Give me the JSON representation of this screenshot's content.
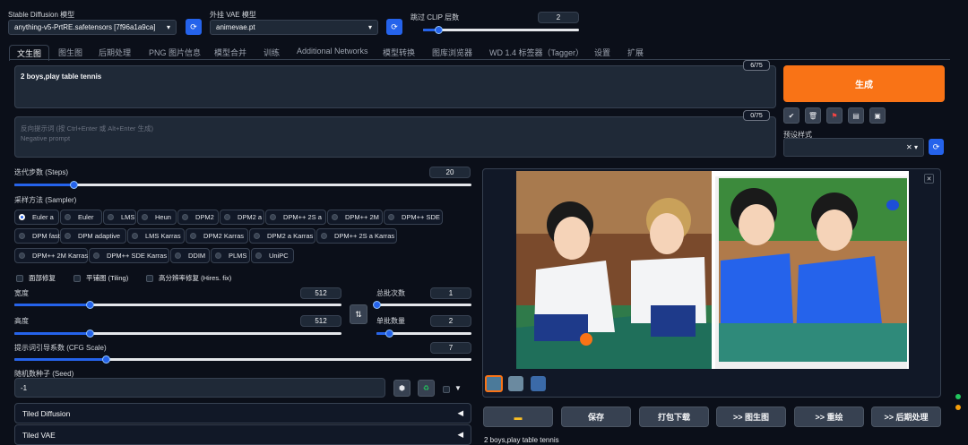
{
  "top": {
    "model_label": "Stable Diffusion 模型",
    "model_value": "anything-v5-PrtRE.safetensors [7f96a1a9ca]",
    "vae_label": "外挂 VAE 模型",
    "vae_value": "animevae.pt",
    "clip_label": "跳过 CLIP 层数",
    "clip_value": "2",
    "clip_level": 0.1
  },
  "tabs": [
    "文生图",
    "图生图",
    "后期处理",
    "PNG 图片信息",
    "模型合并",
    "训练",
    "Additional Networks",
    "模型转换",
    "图库浏览器",
    "WD 1.4 标签器（Tagger）",
    "设置",
    "扩展"
  ],
  "prompt": {
    "text": "2 boys,play table tennis",
    "count": "6/75",
    "neg_placeholder_1": "反向提示词 (按 Ctrl+Enter 或 Alt+Enter 生成)",
    "neg_placeholder_2": "Negative prompt",
    "neg_count": "0/75"
  },
  "generate": {
    "label": "生成",
    "style_label": "预设样式",
    "accent": "#f97316"
  },
  "tool_icons": [
    "check-icon",
    "trash-icon",
    "bookmark-icon",
    "clipboard-icon",
    "save-style-icon"
  ],
  "steps": {
    "label": "迭代步数 (Steps)",
    "value": "20",
    "level": 0.13
  },
  "sampler": {
    "label": "采样方法 (Sampler)",
    "selected": "Euler a",
    "options": [
      "Euler a",
      "Euler",
      "LMS",
      "Heun",
      "DPM2",
      "DPM2 a",
      "DPM++ 2S a",
      "DPM++ 2M",
      "DPM++ SDE",
      "DPM fast",
      "DPM adaptive",
      "LMS Karras",
      "DPM2 Karras",
      "DPM2 a Karras",
      "DPM++ 2S a Karras",
      "DPM++ 2M Karras",
      "DPM++ SDE Karras",
      "DDIM",
      "PLMS",
      "UniPC"
    ]
  },
  "checks": {
    "restore_faces": "面部修复",
    "tiling": "平铺图 (Tiling)",
    "hires": "高分辨率修复 (Hires. fix)"
  },
  "width": {
    "label": "宽度",
    "value": "512",
    "level": 0.23
  },
  "height": {
    "label": "高度",
    "value": "512",
    "level": 0.23
  },
  "batch_count": {
    "label": "总批次数",
    "value": "1",
    "level": 0.0
  },
  "batch_size": {
    "label": "单批数量",
    "value": "2",
    "level": 0.13
  },
  "swap_icon": "swap-icon",
  "cfg": {
    "label": "提示词引导系数 (CFG Scale)",
    "value": "7",
    "level": 0.2
  },
  "seed": {
    "label": "随机数种子 (Seed)",
    "value": "-1"
  },
  "accordions": [
    "Tiled Diffusion",
    "Tiled VAE"
  ],
  "gallery": {
    "caption": "2 boys,play table tennis"
  },
  "actions": [
    "folder-icon",
    "保存",
    "打包下载",
    ">> 图生图",
    ">> 重绘",
    ">> 后期处理"
  ]
}
